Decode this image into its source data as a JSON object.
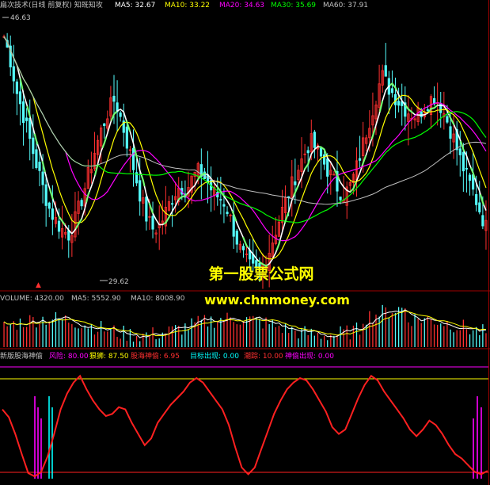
{
  "price_panel": {
    "title": "扁次技术(日线 前复权) 知既知攻",
    "ma_labels": [
      {
        "text": "MA5: 32.67",
        "color": "#ffffff"
      },
      {
        "text": "MA10: 33.22",
        "color": "#ffff00"
      },
      {
        "text": "MA20: 34.63",
        "color": "#ff00ff"
      },
      {
        "text": "MA30: 35.69",
        "color": "#00ff00"
      },
      {
        "text": "MA60: 37.91",
        "color": "#c0c0c0"
      }
    ],
    "high_label": "46.63",
    "low_label": "29.62"
  },
  "volume_panel": {
    "labels": [
      {
        "text": "VOLUME: 4320.00",
        "color": "#c0c0c0"
      },
      {
        "text": "MA5: 5552.90",
        "color": "#c0c0c0"
      },
      {
        "text": "MA10: 8008.90",
        "color": "#c0c0c0"
      }
    ]
  },
  "indicator_panel": {
    "labels": [
      {
        "text": "新版股海神偷",
        "color": "#c0c0c0"
      },
      {
        "text": "风险: 80.00",
        "color": "#ff00ff"
      },
      {
        "text": "狠狮: 87.50",
        "color": "#ffff00"
      },
      {
        "text": "股海神偷: 6.95",
        "color": "#ff3030"
      },
      {
        "text": "目标出现: 0.00",
        "color": "#00ffff"
      },
      {
        "text": "潮踪: 10.00",
        "color": "#ff3030"
      },
      {
        "text": "神偷出现: 0.00",
        "color": "#ff00ff"
      }
    ]
  },
  "watermark": {
    "line1": "第一股票公式网",
    "line2": "www.chnmoney.com",
    "color": "#ffff00"
  },
  "chart_data": [
    {
      "type": "line",
      "title": "",
      "ylim": [
        29.0,
        47.5
      ],
      "series": [
        {
          "name": "MA5",
          "color": "#ffffff"
        },
        {
          "name": "MA10",
          "color": "#ffff00"
        },
        {
          "name": "MA20",
          "color": "#ff00ff"
        },
        {
          "name": "MA30",
          "color": "#00ff00"
        },
        {
          "name": "MA60",
          "color": "#c0c0c0"
        }
      ],
      "close_path": [
        45.8,
        44.2,
        42.0,
        40.5,
        38.8,
        37.2,
        35.6,
        34.2,
        33.4,
        32.8,
        32.5,
        33.6,
        35.0,
        36.6,
        38.2,
        39.6,
        40.8,
        41.6,
        40.2,
        38.5,
        36.8,
        35.0,
        33.5,
        32.8,
        33.2,
        34.2,
        35.2,
        35.8,
        35.5,
        36.4,
        36.8,
        36.2,
        35.4,
        35.0,
        34.6,
        33.2,
        31.8,
        30.8,
        30.2,
        30.0,
        30.6,
        31.8,
        33.2,
        34.5,
        35.6,
        36.8,
        37.8,
        38.8,
        38.2,
        37.4,
        36.6,
        35.8,
        35.2,
        35.6,
        36.8,
        38.4,
        40.0,
        41.6,
        43.2,
        42.4,
        41.8,
        41.2,
        40.8,
        40.5,
        40.8,
        41.4,
        41.8,
        41.2,
        40.2,
        39.0,
        37.6,
        36.4,
        35.4,
        34.2,
        33.0
      ],
      "high": 46.63,
      "low": 29.62
    },
    {
      "type": "bar",
      "title": "",
      "ylim": [
        0,
        16000
      ],
      "series": [
        {
          "name": "VOLUME",
          "color": "#ff3030"
        },
        {
          "name": "MA5",
          "color": "#ffffff"
        },
        {
          "name": "MA10",
          "color": "#ffff00"
        }
      ],
      "last": {
        "volume": 4320.0,
        "ma5": 5552.9,
        "ma10": 8008.9
      }
    },
    {
      "type": "line",
      "title": "",
      "ylim": [
        0,
        100
      ],
      "reference_lines": [
        {
          "name": "风险",
          "value": 80
        },
        {
          "name": "狠狮",
          "value": 87.5
        },
        {
          "name": "潮踪",
          "value": 10
        }
      ],
      "series": [
        {
          "name": "股海神偷",
          "color": "#ff2020",
          "values": [
            62,
            55,
            40,
            22,
            5,
            2,
            6,
            20,
            40,
            62,
            76,
            86,
            92,
            80,
            70,
            62,
            56,
            58,
            64,
            62,
            50,
            40,
            30,
            36,
            50,
            58,
            66,
            72,
            78,
            86,
            90,
            86,
            78,
            70,
            62,
            48,
            28,
            10,
            4,
            10,
            26,
            42,
            58,
            70,
            80,
            86,
            90,
            88,
            80,
            70,
            60,
            46,
            40,
            44,
            58,
            72,
            84,
            92,
            88,
            78,
            70,
            62,
            54,
            44,
            38,
            44,
            52,
            48,
            40,
            30,
            22,
            18,
            12,
            6,
            4,
            7
          ]
        },
        {
          "name": "目标出现",
          "color": "#00ffff"
        },
        {
          "name": "神偷出现",
          "color": "#ff00ff"
        }
      ],
      "last": 6.95
    }
  ]
}
